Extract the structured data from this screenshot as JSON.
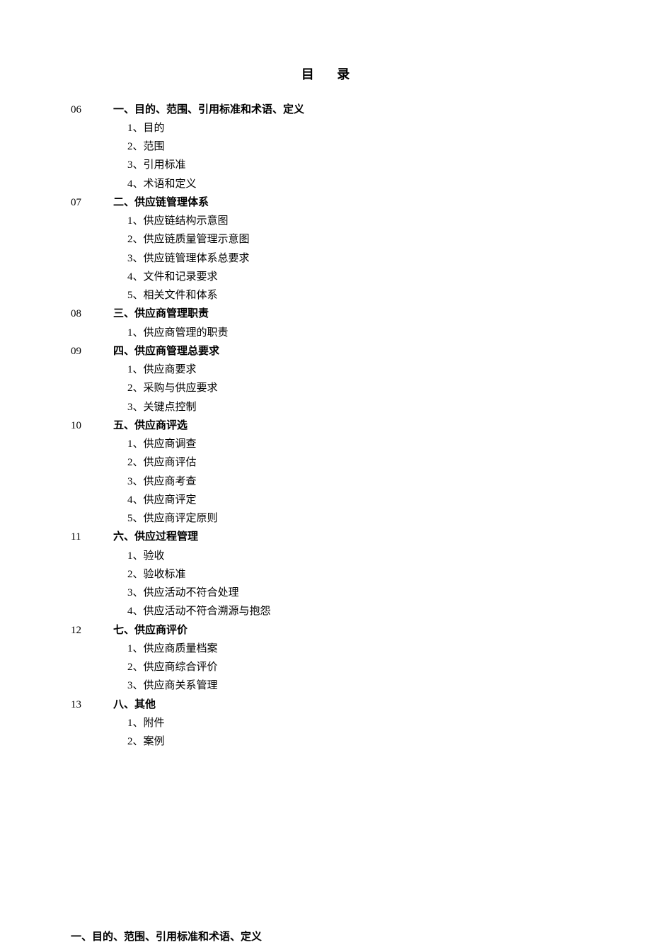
{
  "title": "目 录",
  "sections": [
    {
      "page": "06",
      "heading": "一、目的、范围、引用标准和术语、定义",
      "items": [
        "1、目的",
        "2、范围",
        "3、引用标准",
        "4、术语和定义"
      ]
    },
    {
      "page": "07",
      "heading": "二、供应链管理体系",
      "items": [
        "1、供应链结构示意图",
        "2、供应链质量管理示意图",
        "3、供应链管理体系总要求",
        "4、文件和记录要求",
        "5、相关文件和体系"
      ]
    },
    {
      "page": "08",
      "heading": "三、供应商管理职责",
      "items": [
        "1、供应商管理的职责"
      ]
    },
    {
      "page": "09",
      "heading": "四、供应商管理总要求",
      "items": [
        "1、供应商要求",
        "2、采购与供应要求",
        "3、关键点控制"
      ]
    },
    {
      "page": "10",
      "heading": "五、供应商评选",
      "items": [
        "1、供应商调查",
        "2、供应商评估",
        "3、供应商考查",
        "4、供应商评定",
        "5、供应商评定原则"
      ]
    },
    {
      "page": "11",
      "heading": "六、供应过程管理",
      "items": [
        "1、验收",
        "2、验收标准",
        "3、供应活动不符合处理",
        "4、供应活动不符合溯源与抱怨"
      ]
    },
    {
      "page": "12",
      "heading": "七、供应商评价",
      "items": [
        "1、供应商质量档案",
        "2、供应商综合评价",
        "3、供应商关系管理"
      ]
    },
    {
      "page": "13",
      "heading": "八、其他",
      "items": [
        "1、附件",
        "2、案例"
      ]
    }
  ],
  "bottomHeading": "一、目的、范围、引用标准和术语、定义"
}
